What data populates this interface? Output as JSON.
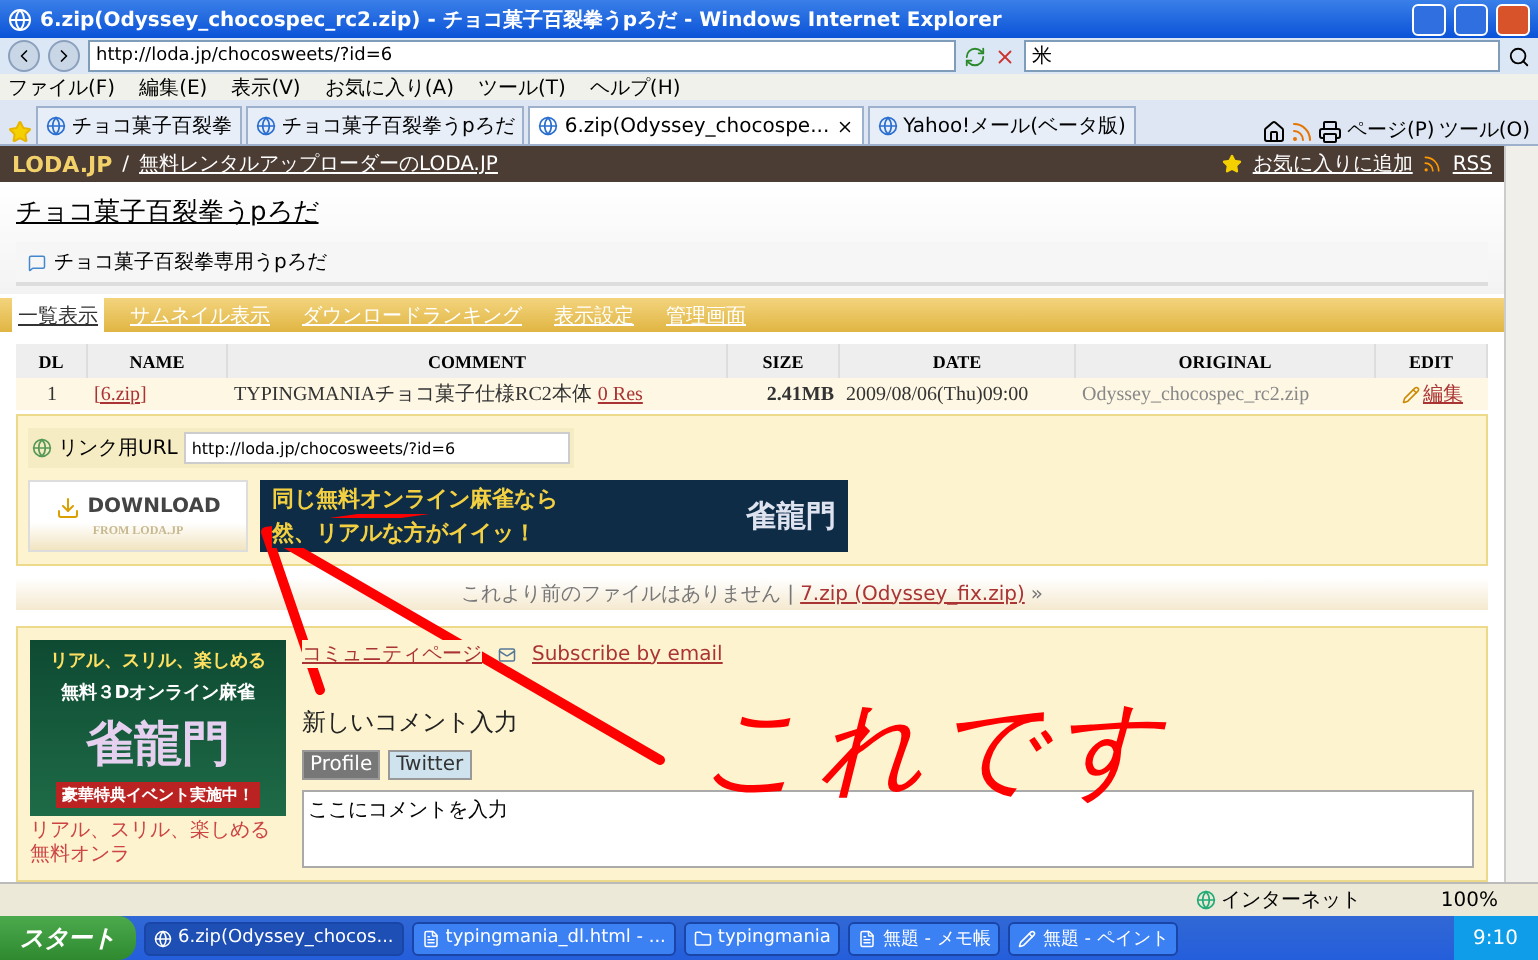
{
  "window": {
    "title": "6.zip(Odyssey_chocospec_rc2.zip) - チョコ菓子百裂拳うpろだ - Windows Internet Explorer"
  },
  "address_bar": {
    "url": "http://loda.jp/chocosweets/?id=6"
  },
  "search_field": {
    "value": "米"
  },
  "menu": [
    "ファイル(F)",
    "編集(E)",
    "表示(V)",
    "お気に入り(A)",
    "ツール(T)",
    "ヘルプ(H)"
  ],
  "tabs": [
    {
      "label": "チョコ菓子百裂拳",
      "selected": false
    },
    {
      "label": "チョコ菓子百裂拳うpろだ",
      "selected": false
    },
    {
      "label": "6.zip(Odyssey_chocospe...",
      "selected": true
    },
    {
      "label": "Yahoo!メール(ベータ版)",
      "selected": false
    }
  ],
  "command_bar": [
    "ページ(P)",
    "ツール(O)"
  ],
  "site_header": {
    "logo": "LODA.JP",
    "separator": "/",
    "tagline": "無料レンタルアップローダーのLODA.JP",
    "favorite": "お気に入りに追加",
    "rss": "RSS"
  },
  "page": {
    "title": "チョコ菓子百裂拳うpろだ",
    "description": "チョコ菓子百裂拳専用うpろだ"
  },
  "nav": [
    {
      "label": "一覧表示",
      "selected": true
    },
    {
      "label": "サムネイル表示",
      "selected": false
    },
    {
      "label": "ダウンロードランキング",
      "selected": false
    },
    {
      "label": "表示設定",
      "selected": false
    },
    {
      "label": "管理画面",
      "selected": false
    }
  ],
  "table": {
    "columns": [
      "DL",
      "NAME",
      "COMMENT",
      "SIZE",
      "DATE",
      "ORIGINAL",
      "EDIT"
    ],
    "rows": [
      {
        "dl": "1",
        "name": "[6.zip]",
        "comment": "TYPINGMANIAチョコ菓子仕様RC2本体",
        "res": "0 Res",
        "size": "2.41MB",
        "date": "2009/08/06(Thu)09:00",
        "original": "Odyssey_chocospec_rc2.zip",
        "edit": "編集"
      }
    ]
  },
  "link_url": {
    "label": "リンク用URL",
    "value": "http://loda.jp/chocosweets/?id=6"
  },
  "download": {
    "label": "DOWNLOAD",
    "sub": "FROM LODA.JP"
  },
  "banner": {
    "line_1": "同じ無料オンライン麻雀なら",
    "line_2": "然、リアルな方がイイッ！",
    "logo": "雀龍門"
  },
  "pager": {
    "text": "これより前のファイルはありません |",
    "link": "7.zip (Odyssey_fix.zip)",
    "arrow": "»"
  },
  "side_ad": {
    "line_1": "リアル、スリル、楽しめる",
    "line_2": "無料３Dオンライン麻雀",
    "logo": "雀龍門",
    "badge": "豪華特典イベント実施中！",
    "caption": "リアル、スリル、楽しめる無料オンラ"
  },
  "community_links": [
    "コミュニティページ",
    "Subscribe by email"
  ],
  "comment_form": {
    "heading": "新しいコメント入力",
    "buttons": [
      "Profile",
      "Twitter"
    ],
    "value": "ここにコメントを入力"
  },
  "status_bar": {
    "zone": "インターネット",
    "zoom": "100%"
  },
  "taskbar": {
    "start": "スタート",
    "buttons": [
      {
        "label": "6.zip(Odyssey_chocos...",
        "selected": true
      },
      {
        "label": "typingmania_dl.html - ...",
        "selected": false
      },
      {
        "label": "typingmania",
        "selected": false
      },
      {
        "label": "無題 - メモ帳",
        "selected": false
      },
      {
        "label": "無題 - ペイント",
        "selected": false
      }
    ],
    "clock": "9:10"
  },
  "annotation": {
    "note": "これです"
  }
}
